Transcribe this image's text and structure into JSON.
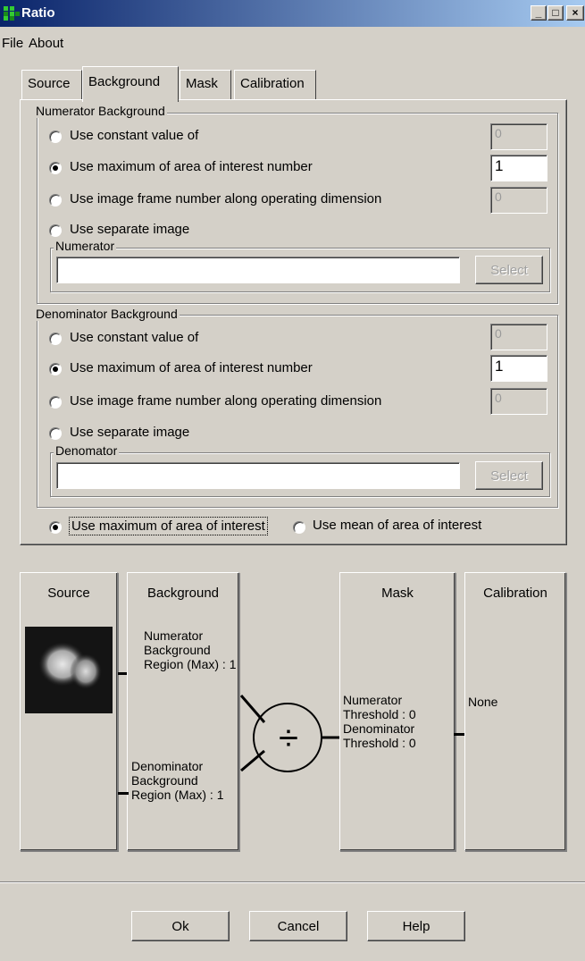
{
  "window": {
    "title": "Ratio",
    "buttons": {
      "minimize": "_",
      "maximize": "□",
      "close": "×"
    }
  },
  "menu": {
    "file": "File",
    "about": "About"
  },
  "tabs": [
    {
      "label": "Source",
      "active": false
    },
    {
      "label": "Background",
      "active": true
    },
    {
      "label": "Mask",
      "active": false
    },
    {
      "label": "Calibration",
      "active": false
    }
  ],
  "numerator": {
    "group_title": "Numerator Background",
    "options": [
      {
        "label": "Use constant value of",
        "selected": false,
        "value": "0",
        "enabled": false
      },
      {
        "label": "Use maximum of area of interest number",
        "selected": true,
        "value": "1",
        "enabled": true
      },
      {
        "label": "Use image frame number along operating dimension",
        "selected": false,
        "value": "0",
        "enabled": false
      },
      {
        "label": "Use separate image",
        "selected": false
      }
    ],
    "image_group_title": "Numerator",
    "image_value": "",
    "select_label": "Select"
  },
  "denominator": {
    "group_title": "Denominator Background",
    "options": [
      {
        "label": "Use constant value of",
        "selected": false,
        "value": "0",
        "enabled": false
      },
      {
        "label": "Use maximum of area of interest number",
        "selected": true,
        "value": "1",
        "enabled": true
      },
      {
        "label": "Use image frame number along operating dimension",
        "selected": false,
        "value": "0",
        "enabled": false
      },
      {
        "label": "Use separate image",
        "selected": false
      }
    ],
    "image_group_title": "Denomator",
    "image_value": "",
    "select_label": "Select"
  },
  "aoi_mode": {
    "max_label": "Use maximum of area of interest",
    "max_selected": true,
    "mean_label": "Use mean of area of interest",
    "mean_selected": false
  },
  "pipeline": {
    "source": {
      "title": "Source"
    },
    "background": {
      "title": "Background",
      "numerator_text": "Numerator Background Region (Max) : 1",
      "denominator_text": "Denominator Background Region (Max) : 1"
    },
    "divide_symbol": "÷",
    "mask": {
      "title": "Mask",
      "text": "Numerator Threshold : 0 Denominator Threshold : 0"
    },
    "calibration": {
      "title": "Calibration",
      "text": "None"
    }
  },
  "footer": {
    "ok": "Ok",
    "cancel": "Cancel",
    "help": "Help"
  }
}
